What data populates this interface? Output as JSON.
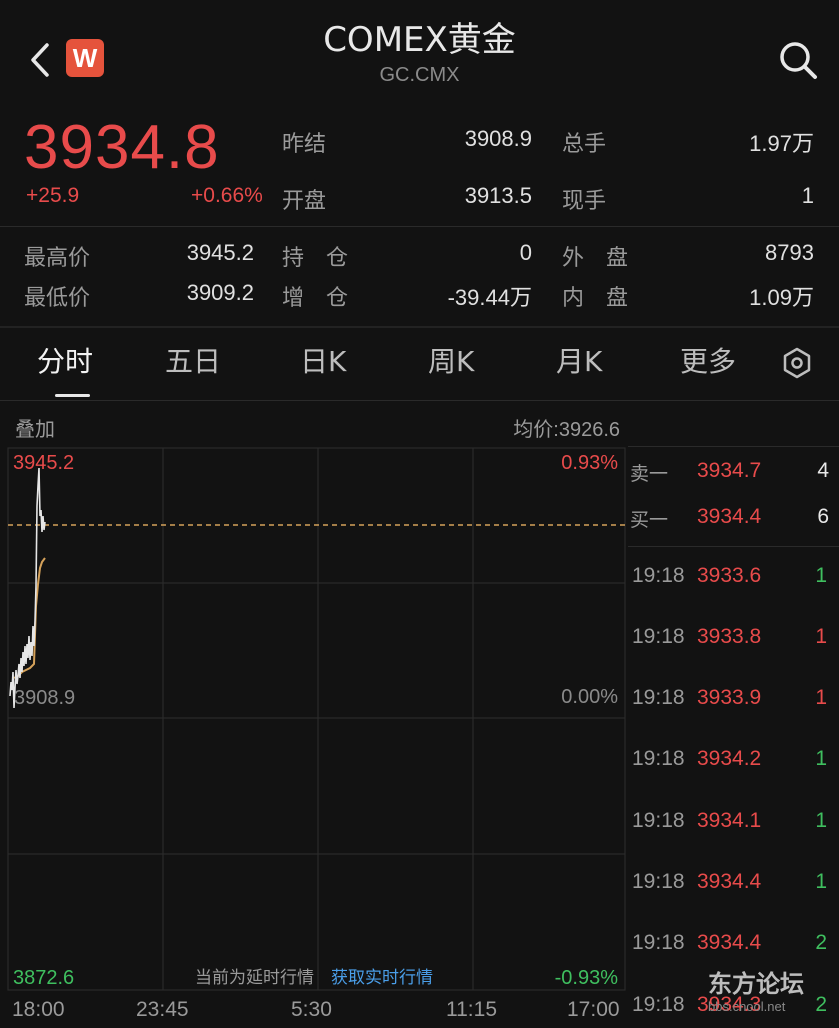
{
  "header": {
    "title": "COMEX黄金",
    "subtitle": "GC.CMX",
    "logo_letter": "W"
  },
  "quote": {
    "price": "3934.8",
    "change": "+25.9",
    "change_pct": "+0.66%",
    "prev_settle_label": "昨结",
    "prev_settle": "3908.9",
    "open_label": "开盘",
    "open": "3913.5",
    "total_volume_label": "总手",
    "total_volume": "1.97万",
    "current_volume_label": "现手",
    "current_volume": "1",
    "high_label": "最高价",
    "high": "3945.2",
    "low_label": "最低价",
    "low": "3909.2",
    "open_interest_label": "持　仓",
    "open_interest": "0",
    "oi_change_label": "增　仓",
    "oi_change": "-39.44万",
    "outer_label": "外　盘",
    "outer": "8793",
    "inner_label": "内　盘",
    "inner": "1.09万"
  },
  "tabs": [
    "分时",
    "五日",
    "日K",
    "周K",
    "月K",
    "更多"
  ],
  "chart": {
    "overlay_label": "叠加",
    "avg_price": "均价:3926.6",
    "y_top": "3945.2",
    "y_mid": "3908.9",
    "y_bottom": "3872.6",
    "pct_top": "0.93%",
    "pct_mid": "0.00%",
    "pct_bottom": "-0.93%",
    "x_ticks": [
      "18:00",
      "23:45",
      "5:30",
      "11:15",
      "17:00"
    ]
  },
  "order_book": {
    "ask_label": "卖一",
    "ask_price": "3934.7",
    "ask_vol": "4",
    "bid_label": "买一",
    "bid_price": "3934.4",
    "bid_vol": "6"
  },
  "trades": [
    {
      "time": "19:18",
      "price": "3933.6",
      "vol": "1",
      "side": "buy"
    },
    {
      "time": "19:18",
      "price": "3933.8",
      "vol": "1",
      "side": "sell"
    },
    {
      "time": "19:18",
      "price": "3933.9",
      "vol": "1",
      "side": "sell"
    },
    {
      "time": "19:18",
      "price": "3934.2",
      "vol": "1",
      "side": "buy"
    },
    {
      "time": "19:18",
      "price": "3934.1",
      "vol": "1",
      "side": "buy"
    },
    {
      "time": "19:18",
      "price": "3934.4",
      "vol": "1",
      "side": "buy"
    },
    {
      "time": "19:18",
      "price": "3934.4",
      "vol": "2",
      "side": "buy"
    },
    {
      "time": "19:18",
      "price": "3934.3",
      "vol": "2",
      "side": "buy"
    }
  ],
  "footer": {
    "delay_notice": "当前为延时行情",
    "realtime_link": "获取实时行情"
  },
  "watermark": {
    "name": "东方论坛",
    "url": "bbs.cnool.net"
  },
  "colors": {
    "up": "#e84b4b",
    "down": "#3fbf5f",
    "avg_line": "#d4a15a",
    "link": "#4a9ee8"
  }
}
